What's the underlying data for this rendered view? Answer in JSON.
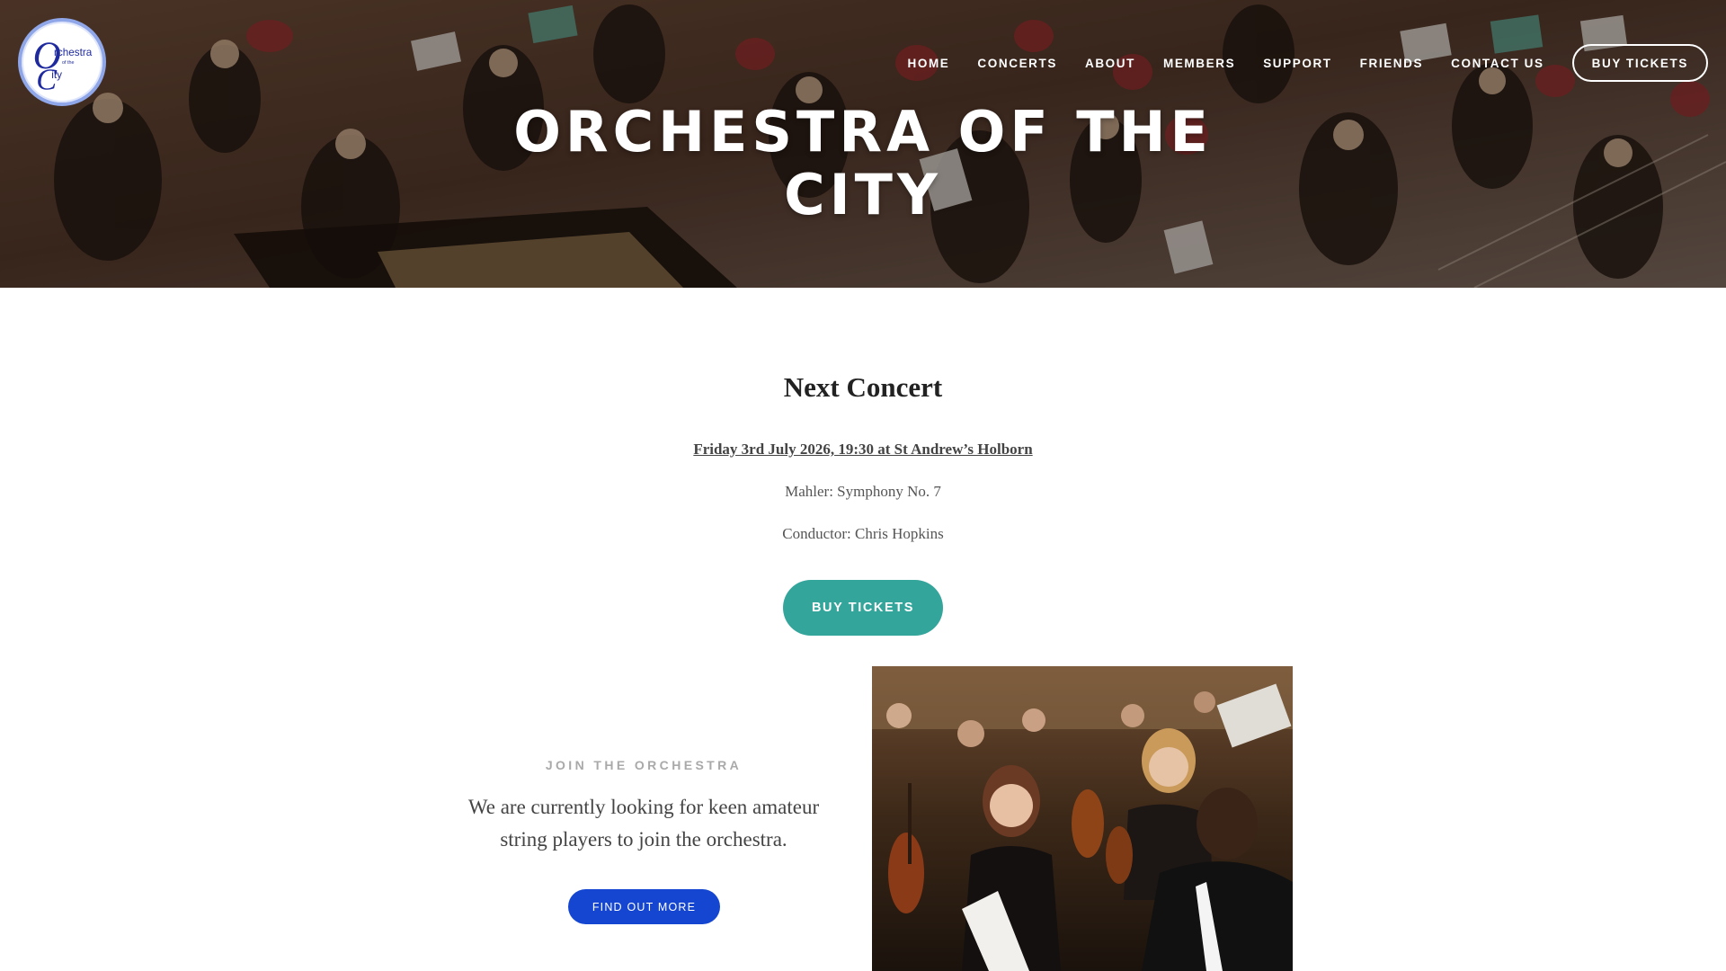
{
  "nav": {
    "items": [
      "HOME",
      "CONCERTS",
      "ABOUT",
      "MEMBERS",
      "SUPPORT",
      "FRIENDS",
      "CONTACT US"
    ],
    "cta_label": "BUY TICKETS"
  },
  "logo": {
    "text_main": "rchestra",
    "text_small": "of the",
    "text_city": "ity",
    "accent_color": "#1f2a9e"
  },
  "hero": {
    "title_line1": "ORCHESTRA OF THE",
    "title_line2": "CITY"
  },
  "concert": {
    "heading": "Next Concert",
    "date_venue": "Friday 3rd July 2026, 19:30 at St Andrew’s Holborn",
    "program": "Mahler: Symphony No. 7",
    "conductor": "Conductor: Chris Hopkins",
    "button_label": "BUY TICKETS",
    "button_color": "#34a59b"
  },
  "join": {
    "label": "JOIN THE ORCHESTRA",
    "text": "We are currently looking for keen amateur string players to join the orchestra.",
    "button_label": "FIND OUT MORE",
    "button_color": "#1546d1"
  }
}
